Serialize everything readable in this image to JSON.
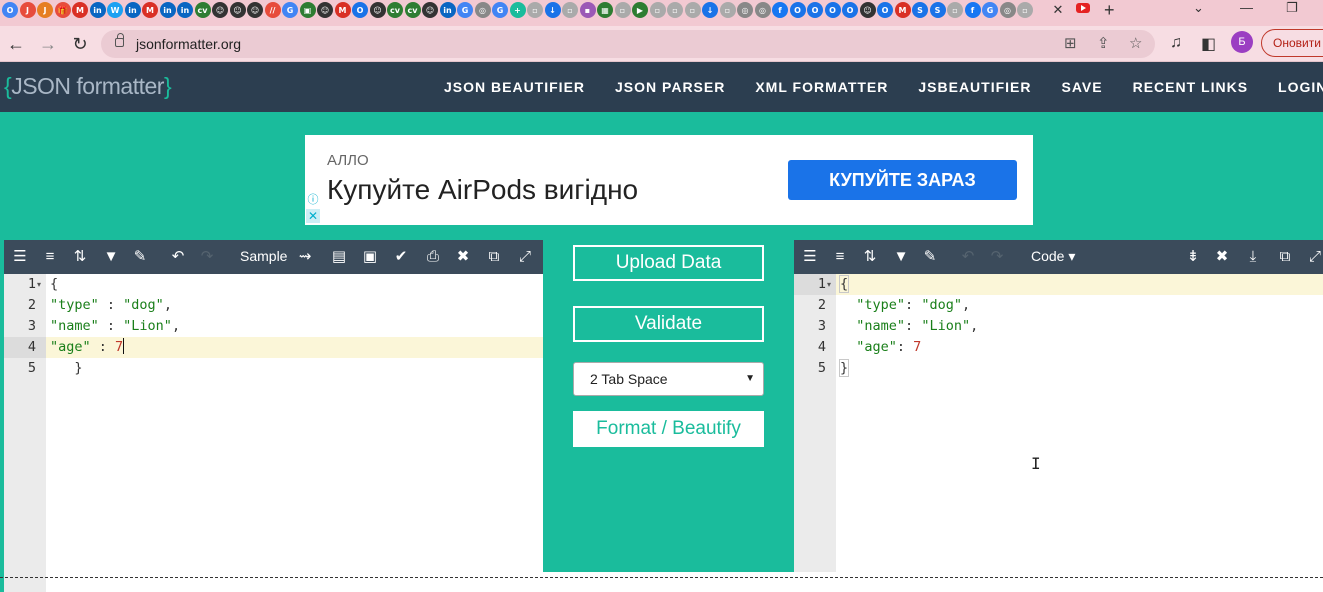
{
  "browser": {
    "url": "jsonformatter.org",
    "tab_close": "✕",
    "new_tab": "+",
    "profile_initial": "Б",
    "update_label": "Оновити",
    "favicons": [
      {
        "c": "#4285f4",
        "t": "O"
      },
      {
        "c": "#e74c3c",
        "t": "J"
      },
      {
        "c": "#e67e22",
        "t": "J"
      },
      {
        "c": "#e74c3c",
        "t": "🎁"
      },
      {
        "c": "#d93025",
        "t": "M"
      },
      {
        "c": "#0a66c2",
        "t": "in"
      },
      {
        "c": "#1da1f2",
        "t": "W"
      },
      {
        "c": "#0a66c2",
        "t": "in"
      },
      {
        "c": "#d93025",
        "t": "M"
      },
      {
        "c": "#0a66c2",
        "t": "in"
      },
      {
        "c": "#0a66c2",
        "t": "in"
      },
      {
        "c": "#2e7d32",
        "t": "cv"
      },
      {
        "c": "#333",
        "t": "☺"
      },
      {
        "c": "#333",
        "t": "☺"
      },
      {
        "c": "#333",
        "t": "☺"
      },
      {
        "c": "#e74c3c",
        "t": "//"
      },
      {
        "c": "#4285f4",
        "t": "G"
      },
      {
        "c": "#2e7d32",
        "t": "▣"
      },
      {
        "c": "#333",
        "t": "☺"
      },
      {
        "c": "#d93025",
        "t": "M"
      },
      {
        "c": "#1a73e8",
        "t": "O"
      },
      {
        "c": "#333",
        "t": "☺"
      },
      {
        "c": "#2e7d32",
        "t": "cv"
      },
      {
        "c": "#2e7d32",
        "t": "cv"
      },
      {
        "c": "#333",
        "t": "☺"
      },
      {
        "c": "#0a66c2",
        "t": "in"
      },
      {
        "c": "#4285f4",
        "t": "G"
      },
      {
        "c": "#888",
        "t": "◎"
      },
      {
        "c": "#4285f4",
        "t": "G"
      },
      {
        "c": "#1abc9c",
        "t": "+"
      },
      {
        "c": "#aaa",
        "t": "▫"
      },
      {
        "c": "#1a73e8",
        "t": "↓"
      },
      {
        "c": "#aaa",
        "t": "▫"
      },
      {
        "c": "#9b59b6",
        "t": "▪"
      },
      {
        "c": "#2e7d32",
        "t": "▦"
      },
      {
        "c": "#aaa",
        "t": "▫"
      },
      {
        "c": "#2e7d32",
        "t": "▶"
      },
      {
        "c": "#aaa",
        "t": "▫"
      },
      {
        "c": "#aaa",
        "t": "▫"
      },
      {
        "c": "#aaa",
        "t": "▫"
      },
      {
        "c": "#1a73e8",
        "t": "↓"
      },
      {
        "c": "#aaa",
        "t": "▫"
      },
      {
        "c": "#888",
        "t": "◎"
      },
      {
        "c": "#888",
        "t": "◎"
      },
      {
        "c": "#1877f2",
        "t": "f"
      },
      {
        "c": "#1a73e8",
        "t": "O"
      },
      {
        "c": "#1a73e8",
        "t": "O"
      },
      {
        "c": "#1a73e8",
        "t": "O"
      },
      {
        "c": "#1a73e8",
        "t": "O"
      },
      {
        "c": "#333",
        "t": "☺"
      },
      {
        "c": "#1a73e8",
        "t": "O"
      },
      {
        "c": "#d93025",
        "t": "M"
      },
      {
        "c": "#1a73e8",
        "t": "S"
      },
      {
        "c": "#1a73e8",
        "t": "S"
      },
      {
        "c": "#aaa",
        "t": "▫"
      },
      {
        "c": "#1877f2",
        "t": "f"
      },
      {
        "c": "#4285f4",
        "t": "G"
      },
      {
        "c": "#888",
        "t": "◎"
      },
      {
        "c": "#aaa",
        "t": "▫"
      }
    ]
  },
  "site": {
    "logo_open": "{",
    "logo_text": "JSON formatter",
    "logo_close": "}",
    "nav": [
      "JSON BEAUTIFIER",
      "JSON PARSER",
      "XML FORMATTER",
      "JSBEAUTIFIER",
      "SAVE",
      "RECENT LINKS",
      "LOGIN"
    ]
  },
  "ad": {
    "brand": "АЛЛО",
    "headline": "Купуйте AirPods вигідно",
    "cta": "КУПУЙТЕ ЗАРАЗ",
    "info_icon": "ⓘ",
    "close_icon": "✕"
  },
  "left_editor": {
    "sample_label": "Sample",
    "line_numbers": [
      "1",
      "2",
      "3",
      "4",
      "5"
    ]
  },
  "right_editor": {
    "mode_label": "Code ▾",
    "line_numbers": [
      "1",
      "2",
      "3",
      "4",
      "5"
    ]
  },
  "controls": {
    "upload": "Upload Data",
    "validate": "Validate",
    "indent_selected": "2 Tab Space",
    "format": "Format / Beautify"
  }
}
